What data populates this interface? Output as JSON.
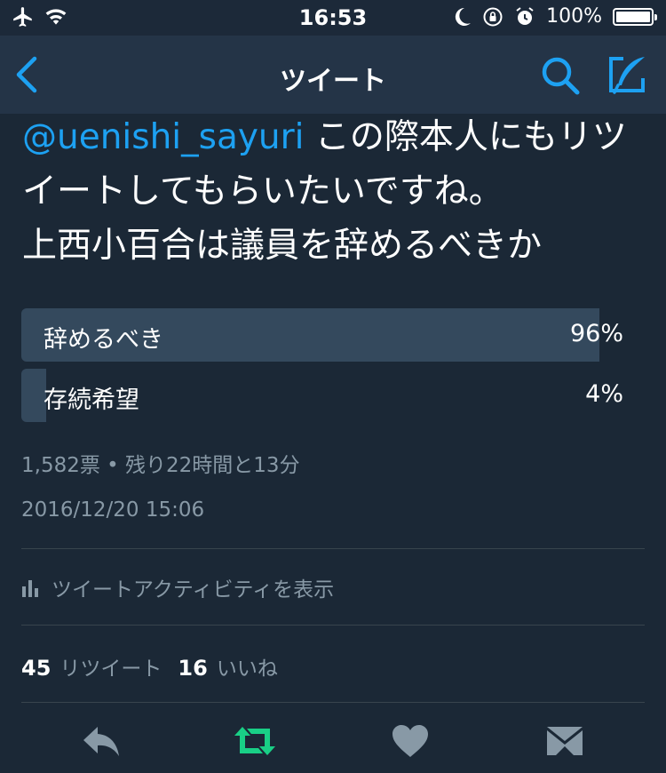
{
  "status_bar": {
    "time": "16:53",
    "battery": "100%",
    "icons": [
      "airplane-icon",
      "wifi-icon",
      "moon-icon",
      "rotation-lock-icon",
      "alarm-icon",
      "battery-icon"
    ]
  },
  "nav": {
    "title": "ツイート",
    "icons": [
      "back-chevron-icon",
      "search-icon",
      "compose-icon"
    ],
    "accent": "#1da1f2"
  },
  "tweet": {
    "mention": "@uenishi_sayuri",
    "text_line1": " この際本人にもリツ",
    "text_line2": "イートしてもらいたいですね。",
    "text_line3": "上西小百合は議員を辞めるべきか"
  },
  "poll": {
    "options": [
      {
        "label": "辞めるべき",
        "percent": "96%",
        "fraction": 0.96
      },
      {
        "label": "存続希望",
        "percent": "4%",
        "fraction": 0.04
      }
    ],
    "summary": "1,582票 • 残り22時間と13分"
  },
  "timestamp": "2016/12/20 15:06",
  "activity_link": "ツイートアクティビティを表示",
  "stats": {
    "retweets_count": "45",
    "retweets_label": "リツイート",
    "likes_count": "16",
    "likes_label": "いいね"
  },
  "actions": {
    "icons": [
      "reply-icon",
      "retweet-icon",
      "like-icon",
      "direct-message-icon"
    ],
    "retweet_color": "#19cf86",
    "default_color": "#8899a6"
  }
}
